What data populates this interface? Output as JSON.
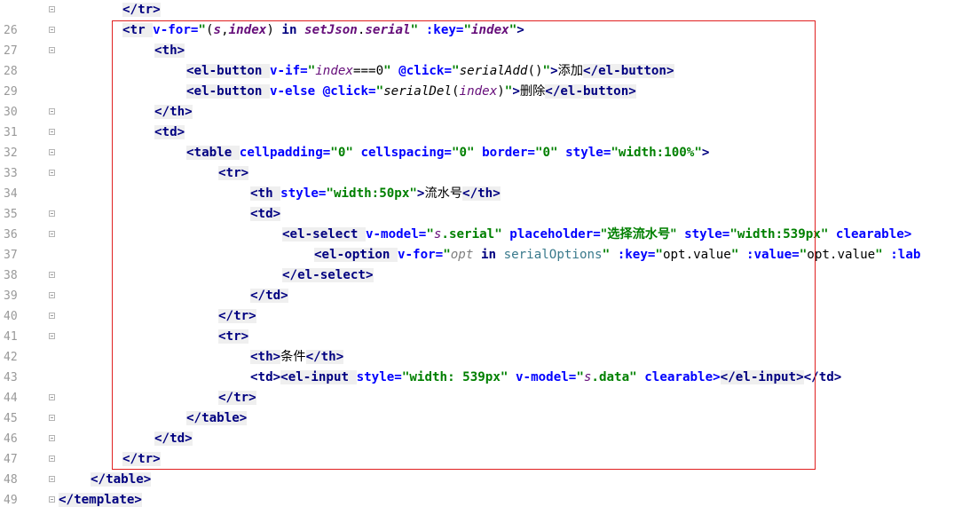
{
  "editor": {
    "lines": [
      {
        "num": "26",
        "code": "</tr>"
      },
      {
        "num": "27",
        "code": "<tr v-for=\"(s,index) in setJson.serial\" :key=\"index\">"
      },
      {
        "num": "28",
        "code": "<th>"
      },
      {
        "num": "29",
        "code": "<el-button v-if=\"index===0\" @click=\"serialAdd()\">添加</el-button>"
      },
      {
        "num": "30",
        "code": "<el-button v-else @click=\"serialDel(index)\">删除</el-button>"
      },
      {
        "num": "31",
        "code": "</th>"
      },
      {
        "num": "32",
        "code": "<td>"
      },
      {
        "num": "33",
        "code": "<table cellpadding=\"0\" cellspacing=\"0\" border=\"0\" style=\"width:100%\">"
      },
      {
        "num": "34",
        "code": "<tr>"
      },
      {
        "num": "35",
        "code": "<th style=\"width:50px\">流水号</th>"
      },
      {
        "num": "36",
        "code": "<td>"
      },
      {
        "num": "37",
        "code": "<el-select v-model=\"s.serial\" placeholder=\"选择流水号\" style=\"width:539px\" clearable>"
      },
      {
        "num": "38",
        "code": "<el-option v-for=\"opt in serialOptions\" :key=\"opt.value\" :value=\"opt.value\" :lab"
      },
      {
        "num": "39",
        "code": "</el-select>"
      },
      {
        "num": "40",
        "code": "</td>"
      },
      {
        "num": "41",
        "code": "</tr>"
      },
      {
        "num": "42",
        "code": "<tr>"
      },
      {
        "num": "43",
        "code": "<th>条件</th>"
      },
      {
        "num": "44",
        "code": "<td><el-input style=\"width: 539px\" v-model=\"s.data\" clearable></el-input></td>"
      },
      {
        "num": "45",
        "code": "</tr>"
      },
      {
        "num": "46",
        "code": "</table>"
      },
      {
        "num": "47",
        "code": "</td>"
      },
      {
        "num": "48",
        "code": "</tr>"
      },
      {
        "num": "49",
        "code": "</table>"
      },
      {
        "num": "50",
        "code": "</template>"
      }
    ]
  },
  "tokens": {
    "l26": [
      "</tr>"
    ],
    "l27": [
      "<tr ",
      "v-for=",
      "\"",
      "(",
      "s",
      ",",
      "index",
      ") ",
      "in ",
      "setJson",
      ".",
      "serial",
      "\"",
      " ",
      ":key=",
      "\"",
      "index",
      "\"",
      ">"
    ],
    "l28": [
      "<th>"
    ],
    "l29": [
      "<el-button ",
      "v-if=",
      "\"",
      "index",
      "===",
      "0",
      "\"",
      " ",
      "@click=",
      "\"",
      "serialAdd",
      "()",
      "\"",
      ">",
      "添加",
      "</el-button>"
    ],
    "l30": [
      "<el-button ",
      "v-else ",
      "@click=",
      "\"",
      "serialDel",
      "(",
      "index",
      ")",
      "\"",
      ">",
      "删除",
      "</el-button>"
    ],
    "l31": [
      "</th>"
    ],
    "l32": [
      "<td>"
    ],
    "l33": [
      "<table ",
      "cellpadding=",
      "\"0\"",
      " ",
      "cellspacing=",
      "\"0\"",
      " ",
      "border=",
      "\"0\"",
      " ",
      "style=",
      "\"width:100%\"",
      ">"
    ],
    "l34": [
      "<tr>"
    ],
    "l35": [
      "<th ",
      "style=",
      "\"width:50px\"",
      ">",
      "流水号",
      "</th>"
    ],
    "l36": [
      "<td>"
    ],
    "l37": [
      "<el-select ",
      "v-model=",
      "\"",
      "s",
      ".serial",
      "\"",
      " ",
      "placeholder=",
      "\"选择流水号\"",
      " ",
      "style=",
      "\"width:539px\"",
      " ",
      "clearable>"
    ],
    "l38": [
      "<el-option ",
      "v-for=",
      "\"",
      "opt ",
      "in ",
      "serialOptions",
      "\"",
      " ",
      ":key=",
      "\"",
      "opt.value",
      "\"",
      " ",
      ":value=",
      "\"",
      "opt.value",
      "\"",
      " ",
      ":lab"
    ],
    "l39": [
      "</el-select>"
    ],
    "l40": [
      "</td>"
    ],
    "l41": [
      "</tr>"
    ],
    "l42": [
      "<tr>"
    ],
    "l43": [
      "<th>",
      "条件",
      "</th>"
    ],
    "l44": [
      "<td>",
      "<el-input ",
      "style=",
      "\"width: 539px\"",
      " ",
      "v-model=",
      "\"",
      "s",
      ".data",
      "\"",
      " ",
      "clearable>",
      "</el-input>",
      "</td>"
    ],
    "l45": [
      "</tr>"
    ],
    "l46": [
      "</table>"
    ],
    "l47": [
      "</td>"
    ],
    "l48": [
      "</tr>"
    ],
    "l49": [
      "</table>"
    ],
    "l50": [
      "</template>"
    ]
  },
  "colors": {
    "tag": "#000080",
    "attribute": "#0000ff",
    "string": "#008000",
    "js_identifier": "#660e7a",
    "line_number": "#999999",
    "selection_box": "#e02020"
  }
}
